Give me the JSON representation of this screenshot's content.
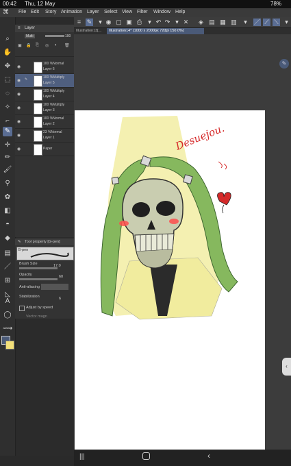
{
  "status": {
    "time": "00:42",
    "date": "Thu, 12 May",
    "battery": "78%"
  },
  "menu": [
    "File",
    "Edit",
    "Story",
    "Animation",
    "Layer",
    "Select",
    "View",
    "Filter",
    "Window",
    "Help"
  ],
  "tabs": [
    {
      "label": "Illustration13[..."
    },
    {
      "label": "Illustration14* (1000 x 2000px 72dpi 150.0%)"
    }
  ],
  "layer_panel": {
    "title": "Layer",
    "blend": "Multi",
    "opacity_value": "100",
    "layers": [
      {
        "mode": "100 %Normal",
        "name": "Layer 6",
        "selected": false
      },
      {
        "mode": "100 %Multiply",
        "name": "Layer 5",
        "selected": true
      },
      {
        "mode": "100 %Multiply",
        "name": "Layer 4",
        "selected": false
      },
      {
        "mode": "100 %Multiply",
        "name": "Layer 3",
        "selected": false
      },
      {
        "mode": "100 %Normal",
        "name": "Layer 2",
        "selected": false
      },
      {
        "mode": "23 %Normal",
        "name": "Layer 1",
        "selected": false
      },
      {
        "mode": "",
        "name": "Paper",
        "selected": false
      }
    ]
  },
  "tool_property": {
    "title": "Tool property [G-pen]",
    "brush_label": "G-pen",
    "brush_size_label": "Brush Size",
    "brush_size_value": "17.0",
    "opacity_label": "Opacity",
    "opacity_value": "60",
    "antialias_label": "Anti-aliasing",
    "stabilization_label": "Stabilization",
    "stabilization_value": "6",
    "adjust_label": "Adjust by speed",
    "vector_label": "Vector magn"
  },
  "canvas": {
    "signature": "Desuejou.",
    "colors": {
      "main": "#4a5a78",
      "hood": "#7fae5a",
      "halo": "#f3eea8",
      "skull": "#c9cdb0"
    }
  }
}
